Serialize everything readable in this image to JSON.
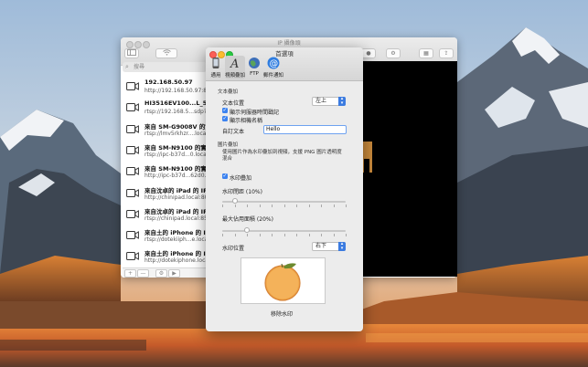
{
  "main_window": {
    "title": "IP 攝像頭",
    "search_placeholder": "搜尋",
    "cameras": [
      {
        "name": "192.168.50.97",
        "url": "http://192.168.50.97:8081"
      },
      {
        "name": "HI3516EV100...L_538",
        "url": "rtsp://192.168.5...sdp?real_"
      },
      {
        "name": "來自 SM-G9008V 的實時",
        "url": "rtsp://lmv5rkhzr....local:85"
      },
      {
        "name": "來自 SM-N9100 的實時影",
        "url": "rtsp://ipc-b37d...0.local:85"
      },
      {
        "name": "來自 SM-N9100 的實時影",
        "url": "http://ipc-b37d...62d0.loca"
      },
      {
        "name": "來自沈卓的 iPad 的 IP 攝像",
        "url": "http://chinipad.local:8081"
      },
      {
        "name": "來自沈卓的 iPad 的 IP 攝像",
        "url": "rtsp://chinipad.local:8554/"
      },
      {
        "name": "來自土的 iPhone 的 IP 攝像",
        "url": "rtsp://dotekiiph...e.local:85"
      },
      {
        "name": "來自土的 iPhone 的 IP 攝像",
        "url": "http://dotekiphone.local:80"
      }
    ],
    "footer_buttons": [
      "+",
      "—",
      "⚙",
      "▶"
    ]
  },
  "prefs": {
    "title": "首選項",
    "tabs": [
      {
        "label": "通用",
        "icon": "phone-icon"
      },
      {
        "label": "視頻疊加",
        "icon": "text-a-icon"
      },
      {
        "label": "FTP",
        "icon": "globe-icon"
      },
      {
        "label": "郵件通知",
        "icon": "at-icon"
      }
    ],
    "text_overlay": {
      "section": "文本疊加",
      "position_label": "文本位置",
      "position_value": "左上",
      "show_timestamp": "顯示伺服器時間戳記",
      "show_camera_name": "顯示相機名稱",
      "custom_text_label": "自訂文本",
      "custom_text_value": "Hello"
    },
    "watermark": {
      "section": "圖片疊加",
      "description": "使用圖片作為水印疊加到視頻，支援 PNG 圖片透明度混合",
      "enable_label": "水印疊加",
      "opacity_label": "水印閉距 (10%)",
      "opacity_value": 0.1,
      "max_area_label": "最大佔用面積 (20%)",
      "max_area_value": 0.2,
      "position_label": "水印位置",
      "position_value": "右下",
      "remove_label": "移除水印"
    }
  },
  "colors": {
    "accent": "#3b7be0",
    "orange": "#f0a545",
    "leaf": "#6b8a2e"
  }
}
